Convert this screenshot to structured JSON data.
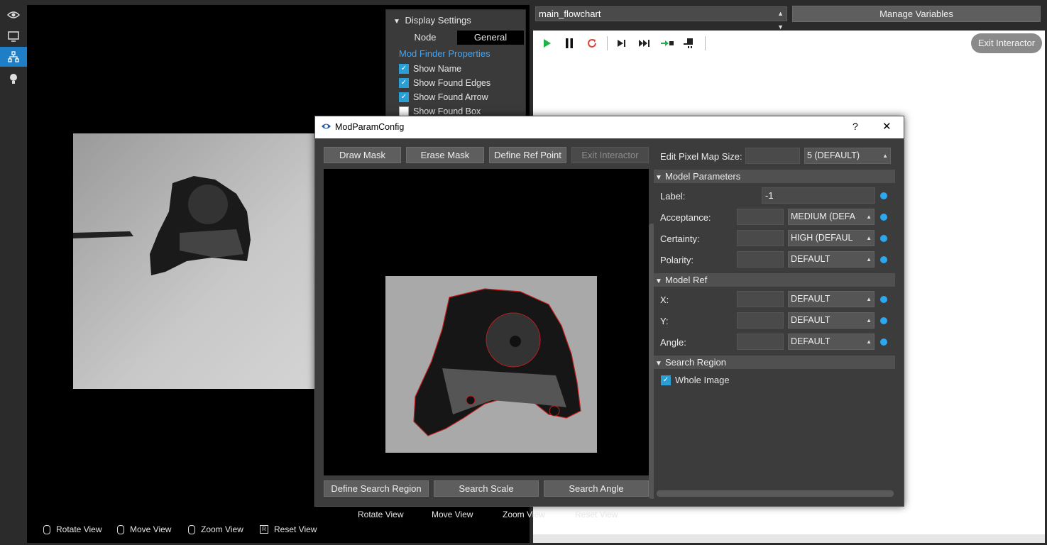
{
  "viewer": {
    "bottom_bar": [
      "Rotate View",
      "Move View",
      "Zoom View",
      "Reset View"
    ]
  },
  "display_settings": {
    "title": "Display Settings",
    "tabs": [
      "Node",
      "General"
    ],
    "active_tab": "General",
    "section": "Mod Finder Properties",
    "options": [
      {
        "label": "Show Name",
        "checked": true
      },
      {
        "label": "Show Found Edges",
        "checked": true
      },
      {
        "label": "Show Found Arrow",
        "checked": true
      },
      {
        "label": "Show Found Box",
        "checked": false
      }
    ]
  },
  "flowchart": {
    "selected": "main_flowchart",
    "manage_label": "Manage Variables",
    "exit_label": "Exit Interactor"
  },
  "dialog": {
    "title": "ModParamConfig",
    "help": "?",
    "close": "✕",
    "top_buttons": [
      "Draw Mask",
      "Erase Mask",
      "Define Ref Point",
      "Exit Interactor"
    ],
    "view_controls": [
      "Rotate View",
      "Move View",
      "Zoom View",
      "Reset View"
    ],
    "bottom_buttons": [
      "Define Search Region",
      "Search Scale",
      "Search Angle"
    ],
    "panel": {
      "pixel_map_label": "Edit Pixel Map Size:",
      "pixel_map_value": "5 (DEFAULT)",
      "model_params_title": "Model Parameters",
      "label_label": "Label:",
      "label_value": "-1",
      "acceptance_label": "Acceptance:",
      "acceptance_value": "MEDIUM (DEFA",
      "certainty_label": "Certainty:",
      "certainty_value": "HIGH (DEFAUL",
      "polarity_label": "Polarity:",
      "polarity_value": "DEFAULT",
      "model_ref_title": "Model Ref",
      "x_label": "X:",
      "x_value": "DEFAULT",
      "y_label": "Y:",
      "y_value": "DEFAULT",
      "angle_label": "Angle:",
      "angle_value": "DEFAULT",
      "search_region_title": "Search Region",
      "whole_image_label": "Whole Image"
    }
  },
  "colors": {
    "accent": "#1e7fc6",
    "dot": "#2aa8f0",
    "play": "#1fb34a",
    "reset": "#e0453a"
  }
}
